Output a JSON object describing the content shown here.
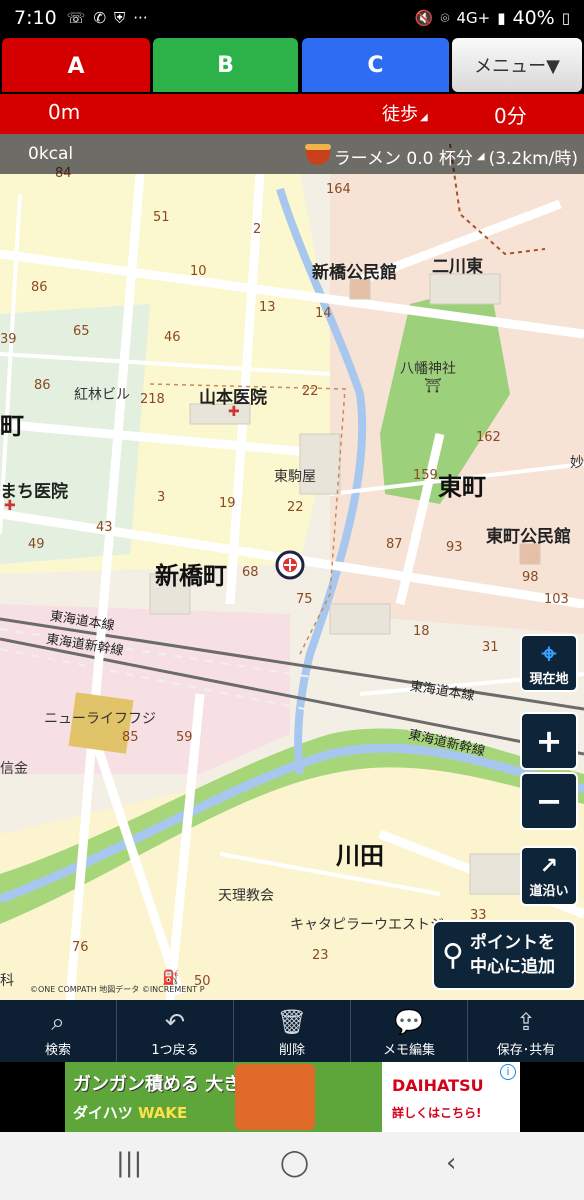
{
  "status": {
    "time": "7:10",
    "signal": "4G+",
    "battery": "40%"
  },
  "tabs": {
    "a": "A",
    "b": "B",
    "c": "C",
    "menu": "メニュー▼"
  },
  "info": {
    "distance": "0m",
    "mode": "徒歩",
    "duration": "0分"
  },
  "kcal": {
    "calories": "0kcal",
    "ramen": "ラーメン 0.0 杯分",
    "speed": "(3.2km/時)"
  },
  "map": {
    "labels": {
      "shinbashi_town": "新橋町",
      "higashi_town": "東町",
      "kawada": "川田",
      "shinbashi_hall": "新橋公民館",
      "nikawa_east": "二川東",
      "yamamoto_clinic": "山本医院",
      "machi_clinic": "まち医院",
      "higashimachi_hall": "東町公民館",
      "hachiman": "八幡神社",
      "kohayashi": "紅林ビル",
      "higashikomaya": "東駒屋",
      "new_life": "ニューライフフジ",
      "tenri": "天理教会",
      "caterpillar": "キャタピラーウエストジ",
      "shinkin": "信金",
      "line1": "東海道本線",
      "line2": "東海道新幹線",
      "line3": "東海道本線",
      "line4": "東海道新幹線",
      "edge_machi": "町",
      "edge_tsuma": "妙",
      "edge_ka": "科"
    },
    "numbers": [
      "84",
      "51",
      "2",
      "164",
      "86",
      "10",
      "13",
      "14",
      "65",
      "46",
      "39",
      "86",
      "218",
      "22",
      "162",
      "159",
      "3",
      "19",
      "22",
      "43",
      "49",
      "87",
      "93",
      "98",
      "68",
      "75",
      "103",
      "18",
      "31",
      "85",
      "59",
      "76",
      "23",
      "50",
      "33"
    ],
    "attribution": "©ONE COMPATH 地図データ ©INCREMENT P"
  },
  "controls": {
    "current_location": "現在地",
    "zoom_in": "+",
    "zoom_out": "−",
    "along_road": "道沿い",
    "add_point": "ポイントを\n中心に追加"
  },
  "toolbar": {
    "search": "検索",
    "back": "1つ戻る",
    "delete": "削除",
    "memo": "メモ編集",
    "save": "保存･共有"
  },
  "ad": {
    "line1": "ガンガン積める 大きな荷室!",
    "line2_prefix": "ダイハツ",
    "line2_car": "WAKE",
    "brand": "DAIHATSU",
    "cta": "詳しくはこちら!"
  },
  "colors": {
    "tab_a": "#d40000",
    "tab_b": "#2db24a",
    "tab_c": "#2f6cf4",
    "toolbar": "#0d1f33"
  }
}
